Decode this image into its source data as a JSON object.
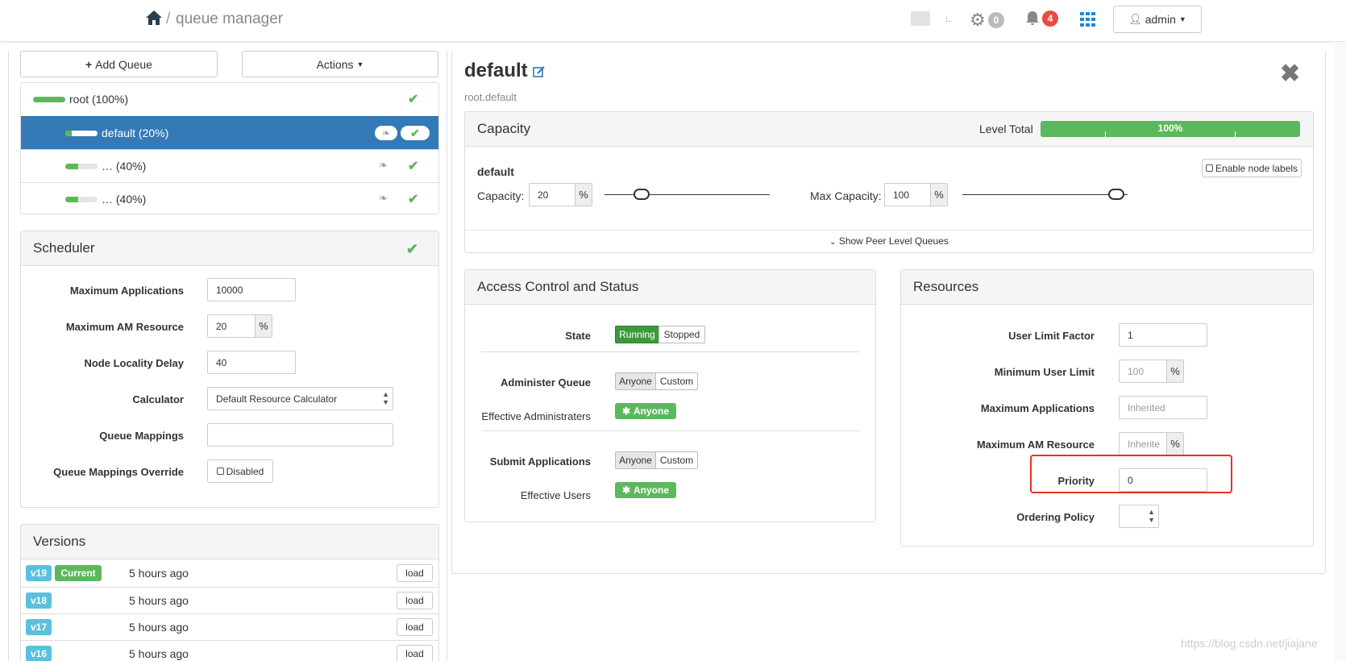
{
  "header": {
    "app_title": "queue manager",
    "separator": "/",
    "settings_count": "0",
    "notifications_count": "4",
    "user_label": "admin"
  },
  "left": {
    "add_queue_label": "Add Queue",
    "actions_label": "Actions",
    "queues": [
      {
        "label": "root (100%)",
        "fill": 1.0
      },
      {
        "label": "default (20%)",
        "fill": 0.2
      },
      {
        "label": "… (40%)",
        "fill": 0.4
      },
      {
        "label": "… (40%)",
        "fill": 0.4
      }
    ],
    "scheduler": {
      "title": "Scheduler",
      "max_apps_label": "Maximum Applications",
      "max_apps_value": "10000",
      "max_am_label": "Maximum AM Resource",
      "max_am_value": "20",
      "percent": "%",
      "node_delay_label": "Node Locality Delay",
      "node_delay_value": "40",
      "calculator_label": "Calculator",
      "calculator_value": "Default Resource Calculator",
      "mappings_label": "Queue Mappings",
      "mappings_value": "",
      "override_label": "Queue Mappings Override",
      "override_value": "Disabled"
    },
    "versions": {
      "title": "Versions",
      "current_label": "Current",
      "load_label": "load",
      "items": [
        {
          "tag": "v19",
          "time": "5 hours ago"
        },
        {
          "tag": "v18",
          "time": "5 hours ago"
        },
        {
          "tag": "v17",
          "time": "5 hours ago"
        },
        {
          "tag": "v16",
          "time": "5 hours ago"
        }
      ]
    }
  },
  "detail": {
    "title": "default",
    "path": "root.default",
    "capacity": {
      "title": "Capacity",
      "level_total_label": "Level Total",
      "level_total_value": "100%",
      "level_total_fraction": 1.0,
      "queue_name": "default",
      "enable_labels": "Enable node labels",
      "capacity_label": "Capacity:",
      "capacity_value": "20",
      "capacity_fraction": 0.2,
      "max_capacity_label": "Max Capacity:",
      "max_capacity_value": "100",
      "max_capacity_fraction": 1.0,
      "percent": "%",
      "peer_link": "Show Peer Level Queues"
    },
    "access": {
      "title": "Access Control and Status",
      "state_label": "State",
      "running": "Running",
      "stopped": "Stopped",
      "admin_label": "Administer Queue",
      "anyone": "Anyone",
      "custom": "Custom",
      "effective_admins_label": "Effective Administraters",
      "anyone_badge": "Anyone",
      "submit_label": "Submit Applications",
      "effective_users_label": "Effective Users"
    },
    "resources": {
      "title": "Resources",
      "ulf_label": "User Limit Factor",
      "ulf_value": "1",
      "min_user_label": "Minimum User Limit",
      "min_user_placeholder": "100",
      "percent": "%",
      "max_apps_label": "Maximum Applications",
      "max_apps_placeholder": "Inherited",
      "max_am_label": "Maximum AM Resource",
      "max_am_placeholder": "Inherite",
      "priority_label": "Priority",
      "priority_value": "0",
      "ordering_label": "Ordering Policy"
    }
  },
  "watermark": "https://blog.csdn.net/jiajane",
  "colors": {
    "primary": "#337ab7",
    "success": "#5cb85c",
    "info": "#5bc0de",
    "danger": "#d9534f",
    "highlight": "#e8321e"
  }
}
